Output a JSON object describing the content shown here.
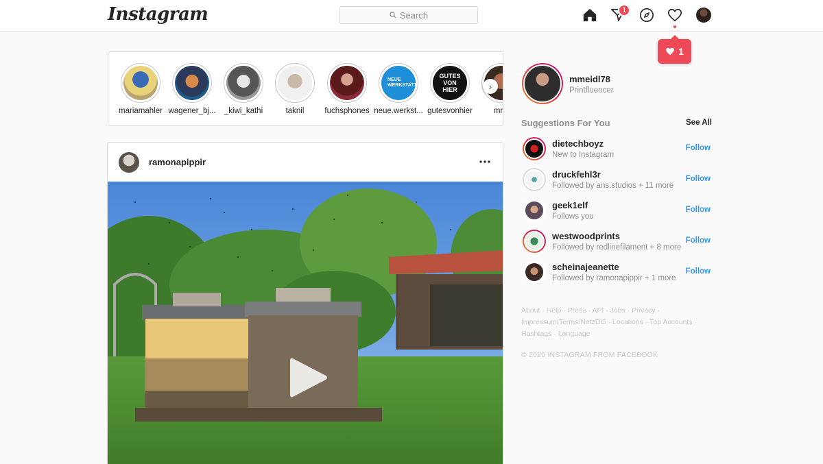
{
  "nav": {
    "logo": "Instagram",
    "search_placeholder": "Search",
    "activity_badge": "1",
    "notification_count": "1",
    "colors": {
      "badge": "#ed4956",
      "link": "#3897f0"
    }
  },
  "stories": [
    {
      "username": "mariamahler"
    },
    {
      "username": "wagener_bj..."
    },
    {
      "username": "_kiwi_kathi"
    },
    {
      "username": "taknil"
    },
    {
      "username": "fuchsphones"
    },
    {
      "username": "neue.werkst..."
    },
    {
      "username": "gutesvonhier"
    },
    {
      "username": "mr.p"
    }
  ],
  "story_logo_text": {
    "neue": "NEUE WERKSTATT",
    "gutes": "GUTES VON HIER"
  },
  "post": {
    "username": "ramonapippir"
  },
  "profile": {
    "username": "mmeidl78",
    "subtitle": "Printfluencer"
  },
  "suggestions": {
    "title": "Suggestions For You",
    "see_all": "See All",
    "follow_label": "Follow",
    "items": [
      {
        "username": "dietechboyz",
        "subtitle": "New to Instagram"
      },
      {
        "username": "druckfehl3r",
        "subtitle": "Followed by ans.studios + 11 more"
      },
      {
        "username": "geek1elf",
        "subtitle": "Follows you"
      },
      {
        "username": "westwoodprints",
        "subtitle": "Followed by redlinefilament + 8 more"
      },
      {
        "username": "scheinajeanette",
        "subtitle": "Followed by ramonapippir + 1 more"
      }
    ]
  },
  "footer": {
    "links": [
      "About",
      "Help",
      "Press",
      "API",
      "Jobs",
      "Privacy",
      "Impressum/Terms/NetzDG",
      "Locations",
      "Top Accounts",
      "Hashtags",
      "Language"
    ],
    "copyright": "© 2020 INSTAGRAM FROM FACEBOOK"
  }
}
